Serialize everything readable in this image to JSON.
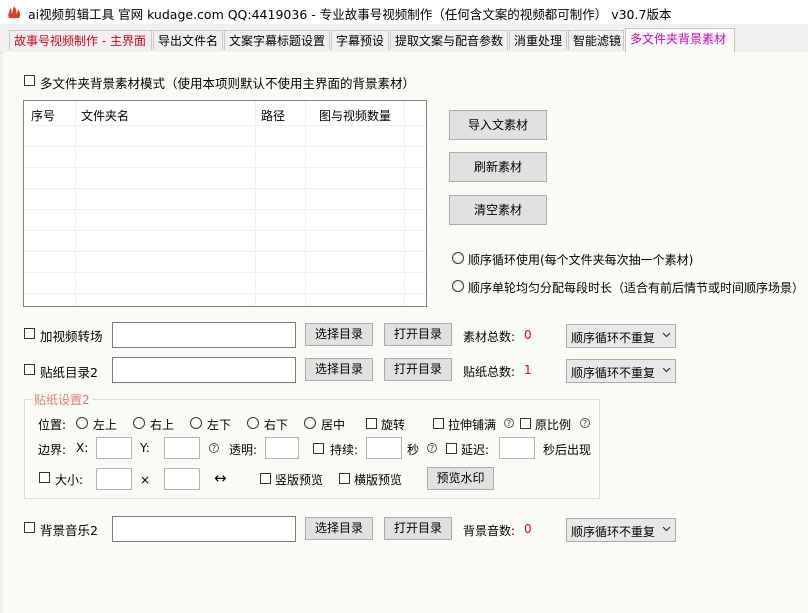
{
  "window": {
    "title": "ai视频剪辑工具 官网 kudage.com QQ:4419036 -  专业故事号视频制作（任何含文案的视频都可制作）  v30.7版本"
  },
  "tabs": [
    {
      "label": "故事号视频制作 - 主界面"
    },
    {
      "label": "导出文件名"
    },
    {
      "label": "文案字幕标题设置"
    },
    {
      "label": "字幕预设"
    },
    {
      "label": "提取文案与配音参数"
    },
    {
      "label": "消重处理"
    },
    {
      "label": "智能滤镜"
    },
    {
      "label": "多文件夹背景素材"
    }
  ],
  "mode": {
    "label": "多文件夹背景素材模式（使用本项则默认不使用主界面的背景素材）"
  },
  "table": {
    "columns": [
      "序号",
      "文件夹名",
      "路径",
      "图与视频数量"
    ]
  },
  "buttons": {
    "import": "导入文素材",
    "refresh": "刷新素材",
    "clear": "清空素材",
    "choose_dir": "选择目录",
    "open_dir": "打开目录",
    "preview_watermark": "预览水印"
  },
  "play_modes": {
    "sequential": "顺序循环使用(每个文件夹每次抽一个素材)",
    "even": "顺序单轮均匀分配每段时长（适合有前后情节或时间顺序场景）"
  },
  "transition": {
    "label": "加视频转场",
    "count_label": "素材总数:",
    "count": "0",
    "mode": "顺序循环不重复"
  },
  "sticker": {
    "label": "贴纸目录2",
    "count_label": "贴纸总数:",
    "count": "1",
    "mode": "顺序循环不重复"
  },
  "sticker_settings": {
    "legend": "贴纸设置2",
    "position_label": "位置:",
    "positions": [
      "左上",
      "右上",
      "左下",
      "右下",
      "居中"
    ],
    "rotate": "旋转",
    "stretch": "拉伸铺满",
    "original_ratio": "原比例",
    "border_label": "边界:",
    "x_label": "X:",
    "y_label": "Y:",
    "opacity_label": "透明:",
    "duration_label": "持续:",
    "seconds": "秒",
    "delay_label": "延迟:",
    "appear_after": "秒后出现",
    "size_label": "大小:",
    "times": "×",
    "swap_symbol": "↔",
    "portrait_preview": "竖版预览",
    "landscape_preview": "横版预览",
    "help_symbol": "?"
  },
  "music": {
    "label": "背景音乐2",
    "count_label": "背景音数:",
    "count": "0",
    "mode": "顺序循环不重复"
  }
}
